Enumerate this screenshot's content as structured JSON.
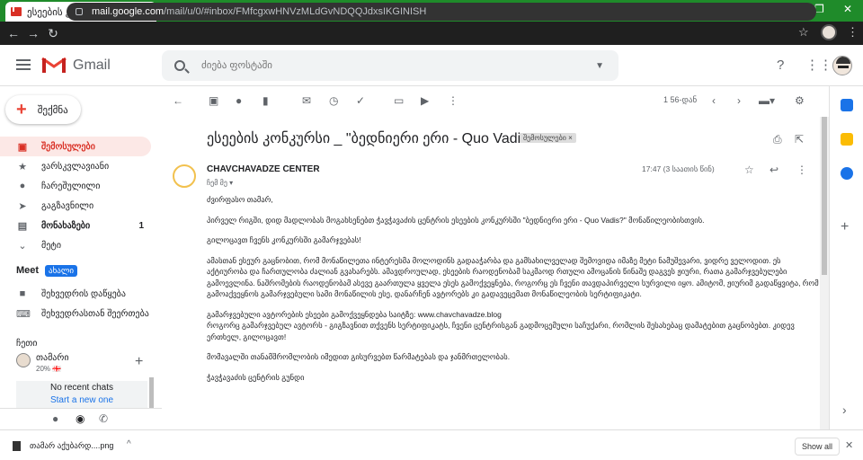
{
  "browser": {
    "tab_title": "ესეების კონკურსი _ \"ბედნიერე",
    "url_host": "mail.google.com",
    "url_path": "/mail/u/0/#inbox/FMfcgxwHNVzMLdGvNDQQJdxsIKGINISH"
  },
  "header": {
    "app_name": "Gmail",
    "search_placeholder": "ძიება ფოსტაში"
  },
  "sidebar": {
    "compose_label": "შექმნა",
    "items": [
      {
        "label": "შემოსულები",
        "active": true,
        "icon": "inbox-icon"
      },
      {
        "label": "ვარსკვლავიანი",
        "icon": "star-icon"
      },
      {
        "label": "ჩარეშულილი",
        "icon": "clock-icon"
      },
      {
        "label": "გაგზავნილი",
        "icon": "send-icon"
      },
      {
        "label": "მონახაზები",
        "count": "1",
        "bold": true,
        "icon": "draft-icon"
      },
      {
        "label": "მეტი",
        "icon": "chevron-down-icon"
      }
    ],
    "meet_label": "Meet",
    "meet_badge": "ახალი",
    "meet_items": [
      "შეხვედრის დაწყება",
      "შეხვედრასთან შეერთება"
    ],
    "chat_label": "ჩეთი",
    "chat_user": "თამარი",
    "chat_status": "20% 🇬🇪",
    "no_chats": "No recent chats",
    "start_chat": "Start a new one"
  },
  "toolbar": {
    "paging": "1 56-დან"
  },
  "message": {
    "subject": "ესეების კონკურსი _ \"ბედნიერი ერი - Quo Vadis\"",
    "label_chip": "შემოსულები ×",
    "sender": "CHAVCHAVADZE CENTER",
    "to_me": "ჩემ მე ▾",
    "time": "17:47 (3 საათის წინ)",
    "paragraphs": [
      "ძვირფასო თამარ,",
      "პირველ რიგში, დიდ მადლობას მოგახსენებთ ჭავჭავაძის ცენტრის ესეების კონკურსში \"ბედნიერი ერი - Quo Vadis?\" მონაწილეობისთვის.",
      "გილოცავთ ჩვენს კონკურსში გამარჯვებას!",
      "ამასთან ესეურ გაცნობით, რომ მონაწილეთა ინტერესმა მოლოდინს გადააჭარბა და  გამსახილველად შემოვიდა იმაზე მეტი ნამუშევარი, ვიდრე ველოდით. ეს აქტიურობა და ჩართულობა ძალიან გვახარებს. ამავდროულად, ესეების რაოდენობამ საკმაოდ რთული ამოცანის წინაშე დაგვეს ჟიური, რათა გამარჯვებულები გამოევლინა. ნაშრომების რაოდენობამ ასევე გაართულა ყველა ესეს გამოქვეყნება, როგორც ეს ჩვენი თავდაპირველი სურვილი იყო. ამიტომ, ჟიურიმ გადაწყვიტა, რომ გამოაქვეყნოს გამარჯვებული სამი მონაწილის ესე, დანარჩენ ავტორებს კი გადავეცემათ მონაწილეობის სერტიფიკატი.",
      "გამარჯვებული ავტორების ესეები გამოქვეყნდება საიტზე: www.chavchavadze.blog\nროგორც გამარჯვებულ ავტორს - გიგზავნით თქვენს სერტიფიკატს, ჩვენი ცენტრისგან გადმოცემული საჩუქარი, რომლის შესახებაც დამატებით გაცნობებთ. კიდევ ერთხელ, გილოცავთ!",
      "მომავალში თანამშრომლობის იმედით გისურვებთ წარმატებას და ჯანმრთელობას.",
      "ჭავჭავაძის ცენტრის გუნდი"
    ]
  },
  "download": {
    "file": "თამარ აქუბარდ....png",
    "show_all": "Show all"
  }
}
